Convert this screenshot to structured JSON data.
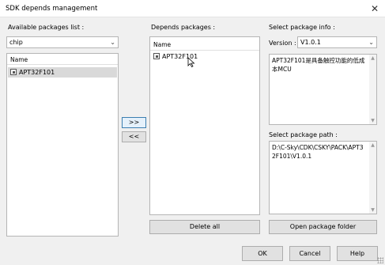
{
  "window": {
    "title": "SDK depends management",
    "close_glyph": "✕"
  },
  "available": {
    "label": "Available packages list :",
    "combo_value": "chip",
    "column": "Name",
    "items": [
      "APT32F101"
    ]
  },
  "transfer": {
    "add_label": ">>",
    "remove_label": "<<"
  },
  "depends": {
    "label": "Depends packages :",
    "column": "Name",
    "items": [
      "APT32F101"
    ],
    "delete_all_label": "Delete all"
  },
  "info": {
    "label": "Select package info :",
    "version_label": "Version :",
    "version_value": "V1.0.1",
    "description": "APT32F101是具备触控功能的低成本MCU"
  },
  "path": {
    "label": "Select package path :",
    "value": "D:\\C-Sky\\CDK\\CSKY\\PACK\\APT32F101\\V1.0.1",
    "open_label": "Open package folder"
  },
  "footer": {
    "ok_label": "OK",
    "cancel_label": "Cancel",
    "help_label": "Help"
  },
  "icons": {
    "combo_arrow": "⌄",
    "scroll_up": "▲",
    "scroll_down": "▼"
  }
}
